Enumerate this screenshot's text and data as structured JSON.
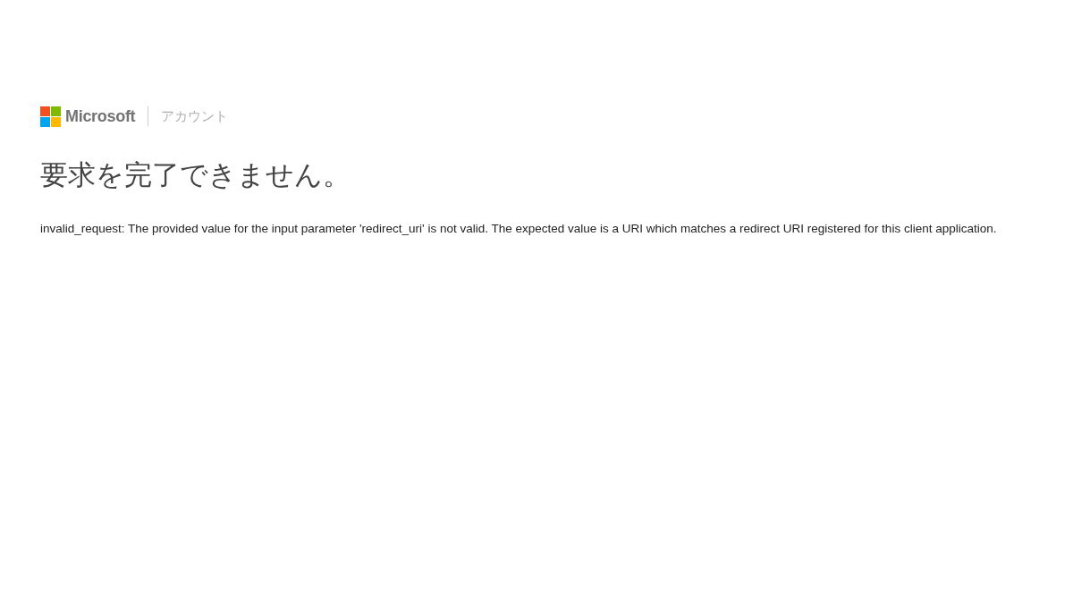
{
  "header": {
    "brand": "Microsoft",
    "section": "アカウント"
  },
  "title": "要求を完了できません。",
  "message": "invalid_request: The provided value for the input parameter 'redirect_uri' is not valid. The expected value is a URI which matches a redirect URI registered for this client application."
}
